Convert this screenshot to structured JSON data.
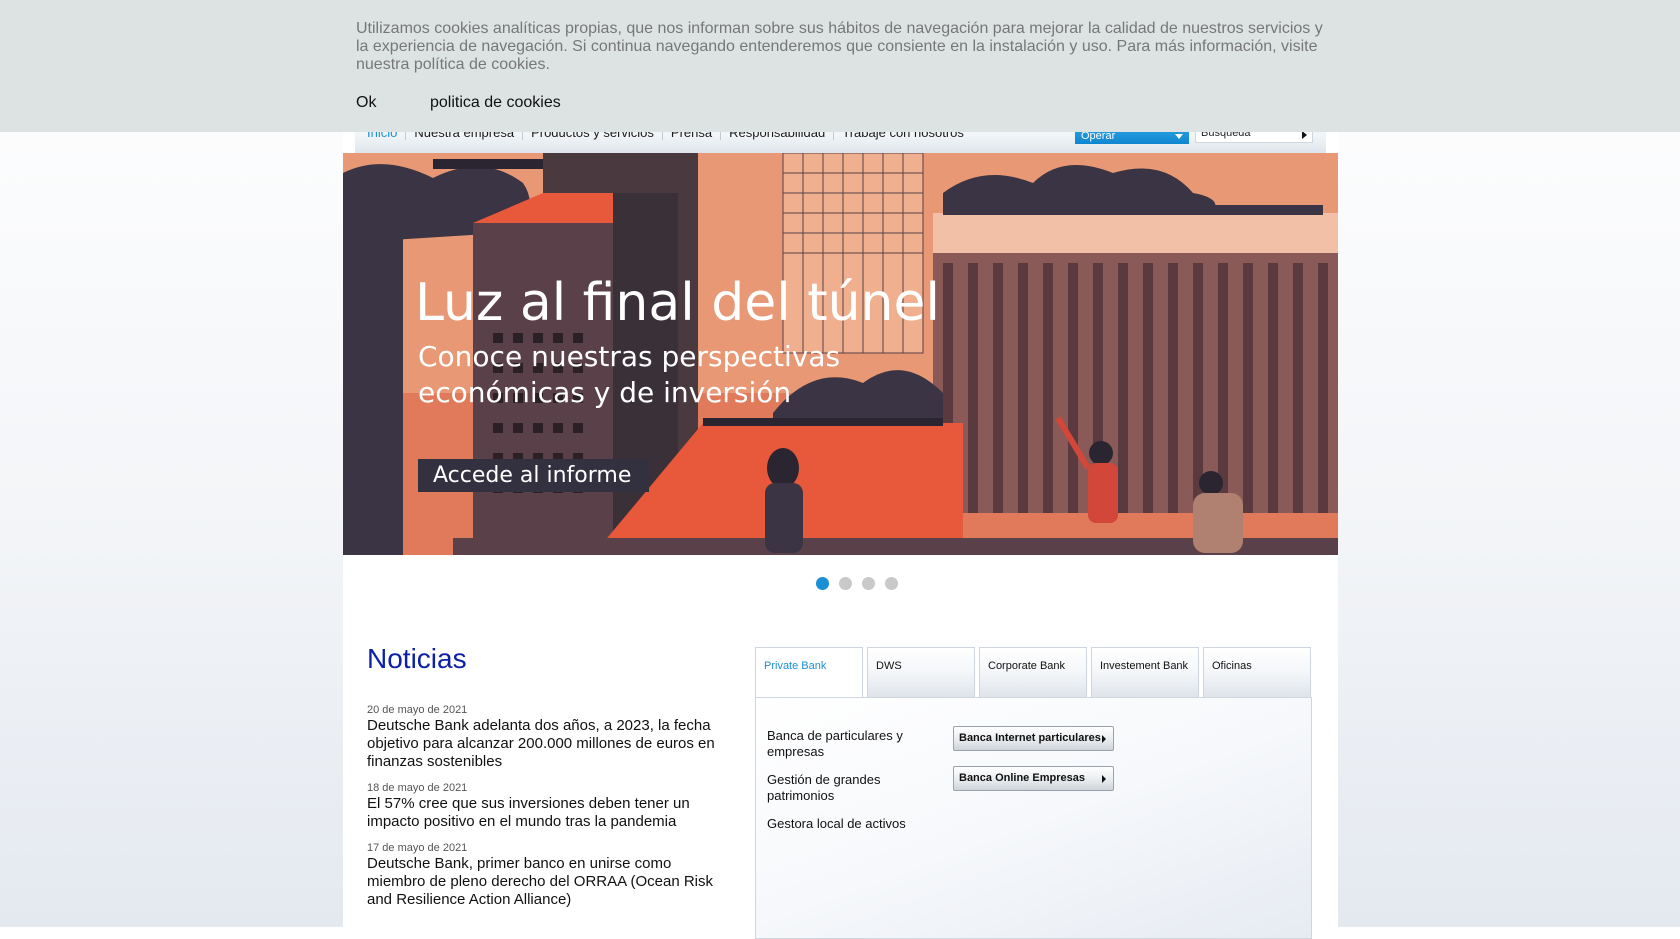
{
  "nav": {
    "items": [
      "Inicio",
      "Nuestra empresa",
      "Productos y servicios",
      "Prensa",
      "Responsabilidad",
      "Trabaje con nosotros"
    ],
    "operar_label": "Operar",
    "search_placeholder": "Búsqueda"
  },
  "hero": {
    "title": "Luz al final del túnel",
    "subtitle": "Conoce nuestras perspectivas económicas y de inversión",
    "cta": "Accede al informe"
  },
  "carousel": {
    "count": 4,
    "active": 1
  },
  "news": {
    "title": "Noticias",
    "items": [
      {
        "date": "20 de mayo de 2021",
        "headline": "Deutsche Bank adelanta dos años, a 2023, la fecha objetivo para alcanzar 200.000 millones de euros en finanzas sostenibles"
      },
      {
        "date": "18 de mayo de 2021",
        "headline": "El 57% cree que sus inversiones deben tener un impacto positivo en el mundo tras la pandemia"
      },
      {
        "date": "17 de mayo de 2021",
        "headline": "Deutsche Bank, primer banco en unirse como miembro de pleno derecho del ORRAA (Ocean Risk and Resilience Action Alliance)"
      }
    ]
  },
  "tabs": {
    "items": [
      "Private Bank",
      "DWS",
      "Corporate Bank",
      "Investement Bank",
      "Oficinas"
    ],
    "active": "Private Bank"
  },
  "panel": {
    "links": [
      "Banca de particulares  y empresas",
      "Gestión de grandes patrimonios",
      "Gestora local de activos"
    ],
    "buttons": [
      "Banca Internet particulares",
      "Banca Online Empresas"
    ]
  },
  "cookie": {
    "text": "Utilizamos cookies analíticas propias, que nos informan sobre sus hábitos de navegación para mejorar la calidad de nuestros servicios y la experiencia de navegación. Si continua navegando entenderemos que consiente en la instalación y uso. Para más información, visite nuestra política de cookies.",
    "ok": "Ok",
    "policy_link": "politica de cookies"
  },
  "colors": {
    "accent": "#1b8fd4",
    "news_title": "#0b1fa8",
    "cookie_bg": "#dde3e3",
    "hero_orange": "#e07355",
    "hero_dark": "#3a3444"
  }
}
